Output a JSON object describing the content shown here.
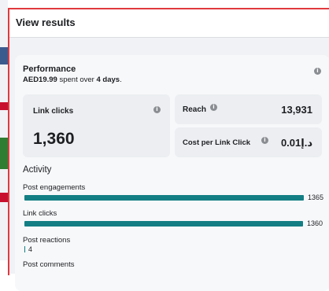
{
  "modal": {
    "title": "View results"
  },
  "performance": {
    "title": "Performance",
    "amount": "AED19.99",
    "spent_text": " spent over ",
    "days": "4 days",
    "period_end": ".",
    "info_icon": "info-icon"
  },
  "metrics": {
    "link_clicks": {
      "label": "Link clicks",
      "value": "1,360"
    },
    "reach": {
      "label": "Reach",
      "value": "13,931"
    },
    "cost_per_link_click": {
      "label": "Cost per Link Click",
      "value": "د.إ0.01"
    }
  },
  "activity": {
    "title": "Activity",
    "max_value": 1365,
    "items": [
      {
        "label": "Post engagements",
        "value": 1365,
        "count": "1365"
      },
      {
        "label": "Link clicks",
        "value": 1360,
        "count": "1360"
      },
      {
        "label": "Post reactions",
        "value": 4,
        "count": "4"
      },
      {
        "label": "Post comments"
      }
    ]
  },
  "colors": {
    "accent_bar": "#137f84",
    "highlight_border": "#e0393e"
  }
}
